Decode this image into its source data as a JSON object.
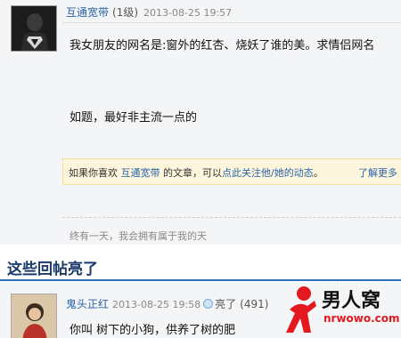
{
  "post": {
    "username": "互通宽带",
    "level": "(1级)",
    "time": "2013-08-25 19:57",
    "body_line1": "我女朋友的网名是:窗外的红杏、烧妖了谁的美。求情侣网名",
    "body_line2": "如题，最好非主流一点的",
    "follow_prefix": "如果你喜欢",
    "follow_user": "互通宽带",
    "follow_mid": "的文章，可以",
    "follow_link": "点此关注他/她的动态",
    "follow_suffix": "。",
    "follow_more": "了解更多",
    "signature": "终有一天，我会拥有属于我的天"
  },
  "hot_section": {
    "title": "这些回帖亮了"
  },
  "reply": {
    "username": "鬼头正红",
    "time": "2013-08-25 19:58",
    "light_label": "亮了",
    "light_count": "(491)",
    "body": "你叫 树下的小狗，供养了树的肥"
  },
  "watermark": {
    "text": "男人窝",
    "url": "nrwowo.com"
  },
  "colors": {
    "link": "#2a63a8",
    "accent": "#2e6fb5",
    "watermark_red": "#e3191f"
  }
}
